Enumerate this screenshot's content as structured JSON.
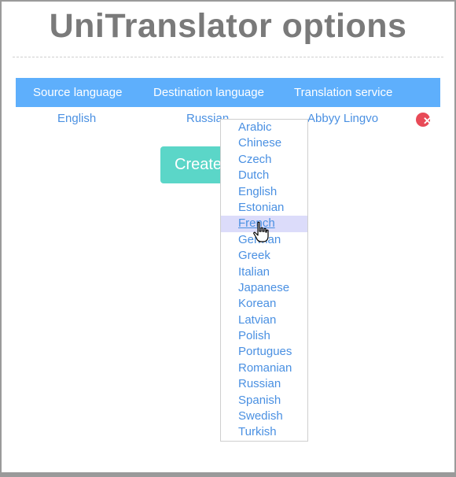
{
  "page": {
    "title": "UniTranslator options"
  },
  "table": {
    "headers": [
      "Source language",
      "Destination language",
      "Translation service"
    ],
    "rows": [
      {
        "source": "English",
        "destination": "Russian",
        "service": "Abbyy Lingvo"
      }
    ]
  },
  "create_button": {
    "label": "Create"
  },
  "dropdown": {
    "options": [
      "Arabic",
      "Chinese",
      "Czech",
      "Dutch",
      "English",
      "Estonian",
      "French",
      "German",
      "Greek",
      "Italian",
      "Japanese",
      "Korean",
      "Latvian",
      "Polish",
      "Portugues",
      "Romanian",
      "Russian",
      "Spanish",
      "Swedish",
      "Turkish"
    ],
    "highlighted": "French"
  },
  "colors": {
    "header_bg": "#5eaffc",
    "button_bg": "#5bd6c8",
    "link": "#4a90e2",
    "delete": "#e84a57"
  },
  "icons": {
    "delete": "close-circle-icon",
    "cursor": "hand-pointer-cursor"
  }
}
